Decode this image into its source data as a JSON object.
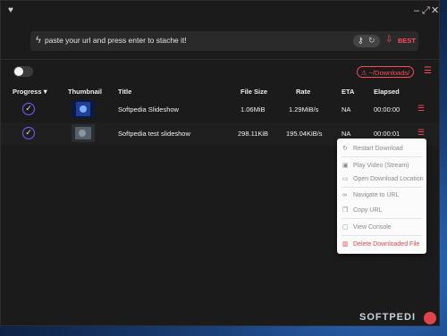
{
  "window": {
    "controls": {
      "minimize": "–",
      "maximize": "⤢",
      "close": "✕"
    }
  },
  "url_bar": {
    "placeholder": "paste your url and press enter to stache it!",
    "quality": "BEST"
  },
  "toolbar": {
    "download_path": "⚠ ~/Downloads/"
  },
  "table": {
    "headers": {
      "progress": "Progress",
      "thumbnail": "Thumbnail",
      "title": "Title",
      "file_size": "File Size",
      "rate": "Rate",
      "eta": "ETA",
      "elapsed": "Elapsed"
    },
    "rows": [
      {
        "title": "Softpedia Slideshow",
        "file_size": "1.06MiB",
        "rate": "1.29MiB/s",
        "eta": "NA",
        "elapsed": "00:00:00"
      },
      {
        "title": "Softpedia test slideshow",
        "file_size": "298.11KiB",
        "rate": "195.04KiB/s",
        "eta": "NA",
        "elapsed": "00:00:01"
      }
    ]
  },
  "context_menu": {
    "items": [
      {
        "label": "Restart Download",
        "icon": "refresh-icon"
      },
      {
        "label": "Play Video (Stream)",
        "icon": "play-icon"
      },
      {
        "label": "Open Download Location",
        "icon": "folder-icon"
      },
      {
        "label": "Navigate to URL",
        "icon": "link-icon"
      },
      {
        "label": "Copy URL",
        "icon": "copy-icon"
      },
      {
        "label": "View Console",
        "icon": "console-icon"
      },
      {
        "label": "Delete Downloaded File",
        "icon": "trash-icon"
      }
    ]
  },
  "watermark": {
    "text": "SOFTPEDI"
  },
  "colors": {
    "accent": "#ff4a5a",
    "progress_ring": "#7c5cff",
    "window_bg": "#1b1b1b"
  }
}
